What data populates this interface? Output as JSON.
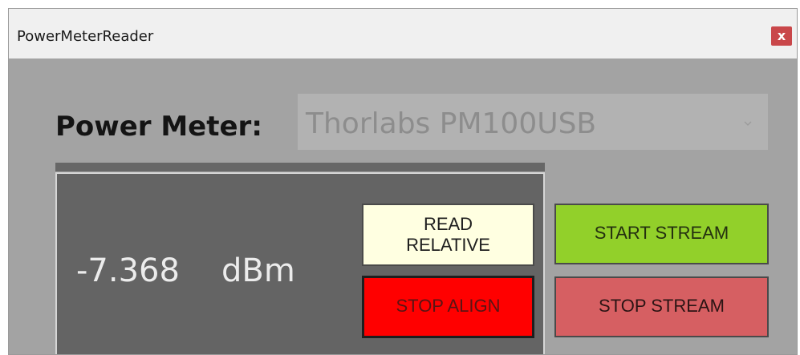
{
  "window": {
    "title": "PowerMeterReader",
    "close_label": "x"
  },
  "power_meter": {
    "label": "Power Meter:",
    "selected": "Thorlabs PM100USB"
  },
  "readout": {
    "value": "-7.368",
    "unit": "dBm"
  },
  "buttons": {
    "read_relative": {
      "line1": "READ",
      "line2": "RELATIVE"
    },
    "stop_align": "STOP ALIGN",
    "start_stream": "START STREAM",
    "stop_stream": "STOP STREAM"
  },
  "colors": {
    "read_relative": "#ffffe1",
    "stop_align": "#ff0000",
    "start_stream": "#92d02a",
    "stop_stream": "#d65f62",
    "close": "#c9474a",
    "panel": "#646464",
    "window_bg": "#a3a3a3"
  },
  "icons": {
    "close": "close-icon",
    "dropdown": "chevron-down-icon"
  }
}
